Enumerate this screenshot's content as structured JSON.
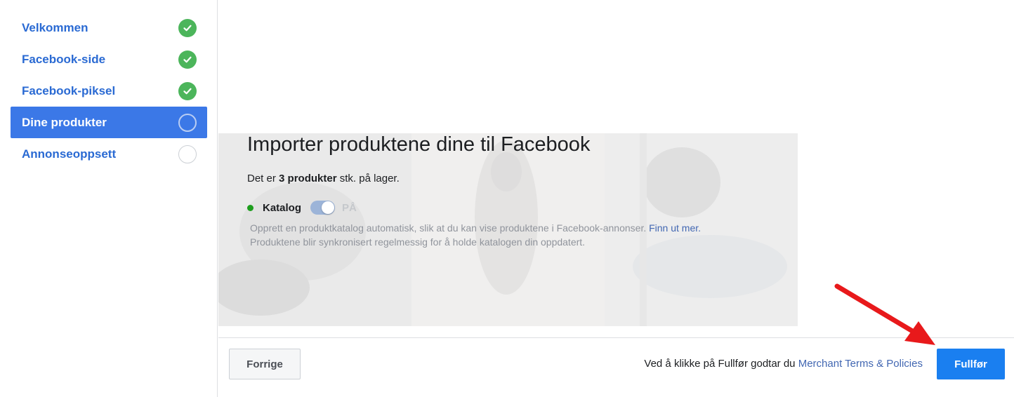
{
  "sidebar": {
    "items": [
      {
        "label": "Velkommen",
        "status": "done"
      },
      {
        "label": "Facebook-side",
        "status": "done"
      },
      {
        "label": "Facebook-piksel",
        "status": "done"
      },
      {
        "label": "Dine produkter",
        "status": "current"
      },
      {
        "label": "Annonseoppsett",
        "status": "todo"
      }
    ]
  },
  "main": {
    "title": "Importer produktene dine til Facebook",
    "stock": {
      "prefix": "Det er",
      "count": "3 produkter",
      "suffix": "stk. på lager."
    },
    "catalog": {
      "label": "Katalog",
      "toggle_on": true,
      "toggle_state": "PÅ",
      "description_line1": "Opprett en produktkatalog automatisk, slik at du kan vise produktene i Facebook-annonser.",
      "learn_more": "Finn ut mer.",
      "description_line2": "Produktene blir synkronisert regelmessig for å holde katalogen din oppdatert."
    }
  },
  "footer": {
    "previous_label": "Forrige",
    "terms_text": "Ved å klikke på Fullfør godtar du",
    "terms_link": "Merchant Terms & Policies",
    "finish_label": "Fullfør"
  },
  "colors": {
    "sidebar_active": "#3b78e7",
    "sidebar_link": "#2a6ad3",
    "check_green": "#4cb55b",
    "primary_button": "#1a7ff0",
    "annotation_arrow": "#e8191b"
  },
  "icons": {
    "done": "check-circle-icon",
    "current": "empty-circle-icon",
    "todo": "empty-circle-icon"
  }
}
